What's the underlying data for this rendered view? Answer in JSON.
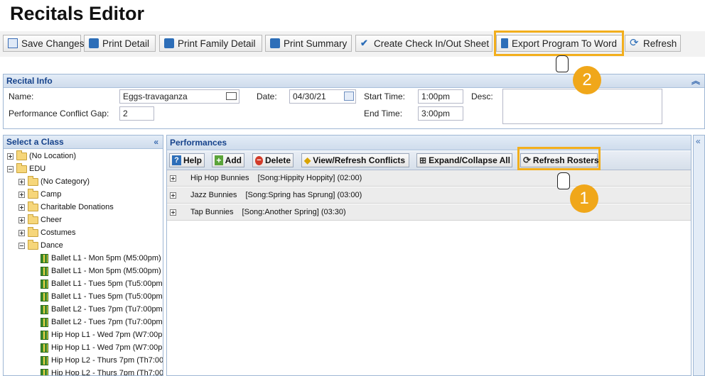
{
  "page": {
    "title": "Recitals Editor"
  },
  "toolbar": {
    "save": "Save Changes",
    "print_detail": "Print Detail",
    "print_family": "Print Family Detail",
    "print_summary": "Print Summary",
    "checkin": "Create Check In/Out Sheet",
    "export": "Export Program To Word",
    "refresh": "Refresh"
  },
  "recital_info": {
    "header": "Recital Info",
    "name_label": "Name:",
    "name_value": "Eggs-travaganza",
    "gap_label": "Performance Conflict Gap:",
    "gap_value": "2",
    "date_label": "Date:",
    "date_value": "04/30/21",
    "start_label": "Start Time:",
    "start_value": "1:00pm",
    "end_label": "End Time:",
    "end_value": "3:00pm",
    "desc_label": "Desc:"
  },
  "class_panel": {
    "header": "Select a Class",
    "items": [
      {
        "label": "(No Location)"
      },
      {
        "label": "EDU"
      },
      {
        "label": "(No Category)"
      },
      {
        "label": "Camp"
      },
      {
        "label": "Charitable Donations"
      },
      {
        "label": "Cheer"
      },
      {
        "label": "Costumes"
      },
      {
        "label": "Dance"
      },
      {
        "label": "Ballet L1 - Mon 5pm (M5:00pm)"
      },
      {
        "label": "Ballet L1 - Mon 5pm (M5:00pm)"
      },
      {
        "label": "Ballet L1 - Tues 5pm (Tu5:00pm"
      },
      {
        "label": "Ballet L1 - Tues 5pm (Tu5:00pm"
      },
      {
        "label": "Ballet L2 - Tues 7pm (Tu7:00pm"
      },
      {
        "label": "Ballet L2 - Tues 7pm (Tu7:00pm"
      },
      {
        "label": "Hip Hop L1 - Wed 7pm (W7:00p"
      },
      {
        "label": "Hip Hop L1 - Wed 7pm (W7:00p"
      },
      {
        "label": "Hip Hop L2 - Thurs 7pm (Th7:00"
      },
      {
        "label": "Hip Hop L2 - Thurs 7pm (Th7:00"
      }
    ]
  },
  "performances": {
    "header": "Performances",
    "buttons": {
      "help": "Help",
      "add": "Add",
      "delete": "Delete",
      "conflicts": "View/Refresh Conflicts",
      "expand": "Expand/Collapse All",
      "refresh_rosters": "Refresh Rosters"
    },
    "rows": [
      {
        "name": "Hip Hop Bunnies",
        "song": "[Song:Hippity Hoppity] (02:00)"
      },
      {
        "name": "Jazz Bunnies",
        "song": "[Song:Spring has Sprung] (03:00)"
      },
      {
        "name": "Tap Bunnies",
        "song": "[Song:Another Spring] (03:30)"
      }
    ]
  },
  "callouts": {
    "step1": "1",
    "step2": "2"
  },
  "colors": {
    "highlight": "#f2ae1c",
    "badge": "#f0a71a",
    "header_text": "#15428b"
  }
}
